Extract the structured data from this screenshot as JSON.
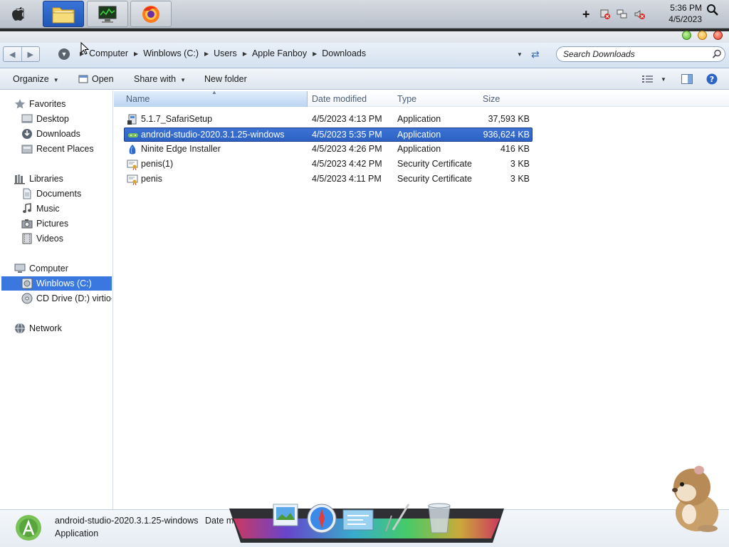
{
  "taskbar": {
    "apps": [
      {
        "name": "file-explorer",
        "active": true
      },
      {
        "name": "task-manager",
        "active": false
      },
      {
        "name": "firefox",
        "active": false
      }
    ],
    "time": "5:36 PM",
    "date": "4/5/2023"
  },
  "address": {
    "crumbs": [
      "Computer",
      "Winblows (C:)",
      "Users",
      "Apple Fanboy",
      "Downloads"
    ],
    "search_placeholder": "Search Downloads"
  },
  "toolbar": {
    "organize": "Organize",
    "open": "Open",
    "share_with": "Share with",
    "new_folder": "New folder"
  },
  "nav": {
    "favorites": "Favorites",
    "desktop": "Desktop",
    "downloads": "Downloads",
    "recent_places": "Recent Places",
    "libraries": "Libraries",
    "documents": "Documents",
    "music": "Music",
    "pictures": "Pictures",
    "videos": "Videos",
    "computer": "Computer",
    "drive_c": "Winblows (C:)",
    "drive_d": "CD Drive (D:) virtio-",
    "network": "Network"
  },
  "columns": {
    "name": "Name",
    "date_modified": "Date modified",
    "type": "Type",
    "size": "Size"
  },
  "files": [
    {
      "name": "5.1.7_SafariSetup",
      "date": "4/5/2023 4:13 PM",
      "type": "Application",
      "size": "37,593 KB",
      "icon": "installer-icon"
    },
    {
      "name": "android-studio-2020.3.1.25-windows",
      "date": "4/5/2023 5:35 PM",
      "type": "Application",
      "size": "936,624 KB",
      "icon": "android-icon",
      "selected": true
    },
    {
      "name": "Ninite Edge Installer",
      "date": "4/5/2023 4:26 PM",
      "type": "Application",
      "size": "416 KB",
      "icon": "ninite-icon"
    },
    {
      "name": "penis(1)",
      "date": "4/5/2023 4:42 PM",
      "type": "Security Certificate",
      "size": "3 KB",
      "icon": "certificate-icon"
    },
    {
      "name": "penis",
      "date": "4/5/2023 4:11 PM",
      "type": "Security Certificate",
      "size": "3 KB",
      "icon": "certificate-icon"
    }
  ],
  "details": {
    "name": "android-studio-2020.3.1.25-windows",
    "date_label": "Date mo",
    "type": "Application"
  },
  "colors": {
    "selection": "#3a78e0",
    "android_green": "#78c257"
  }
}
